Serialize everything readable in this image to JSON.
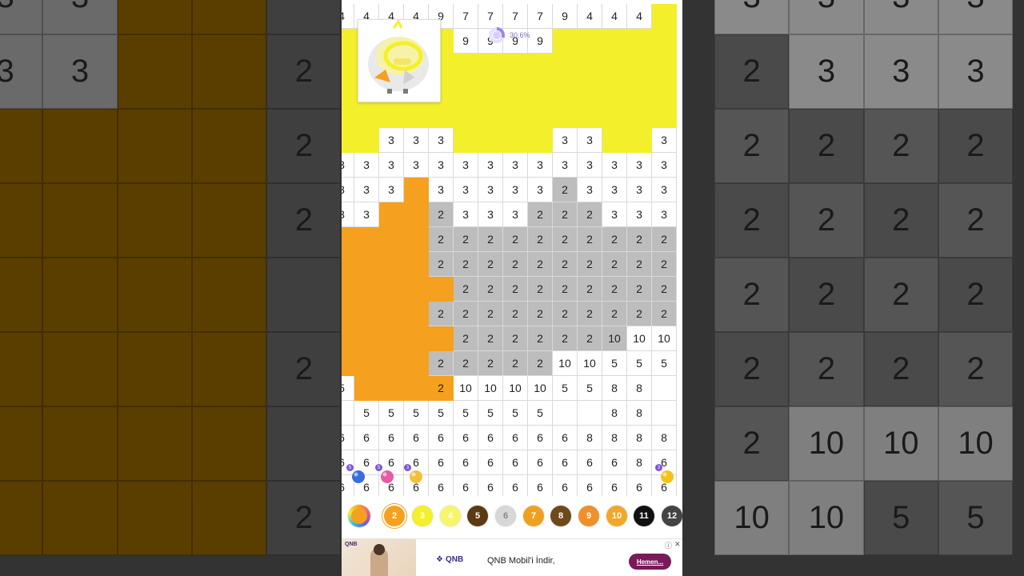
{
  "progress": {
    "percent_label": "30.6%",
    "value": 0.306
  },
  "grid_rows": [
    [
      "4",
      "4",
      "4",
      "4",
      "9",
      "7",
      "7",
      "7",
      "7",
      "9",
      "4",
      "4",
      "4",
      ""
    ],
    [
      "",
      "",
      "",
      "",
      "",
      "9",
      "9",
      "9",
      "9",
      "",
      "",
      "",
      "",
      ""
    ],
    [
      "",
      "",
      "",
      "",
      "",
      "",
      "",
      "",
      "",
      "",
      "",
      "",
      "",
      ""
    ],
    [
      "",
      "",
      "",
      "",
      "",
      "",
      "",
      "",
      "",
      "",
      "",
      "",
      "",
      ""
    ],
    [
      "",
      "",
      "",
      "",
      "",
      "",
      "",
      "",
      "",
      "",
      "",
      "",
      "",
      ""
    ],
    [
      "",
      "",
      "3",
      "3",
      "3",
      "",
      "",
      "",
      "",
      "3",
      "3",
      "",
      "",
      "3"
    ],
    [
      "3",
      "3",
      "3",
      "3",
      "3",
      "3",
      "3",
      "3",
      "3",
      "3",
      "3",
      "3",
      "3",
      "3"
    ],
    [
      "3",
      "3",
      "3",
      "",
      "3",
      "3",
      "3",
      "3",
      "3",
      "2",
      "3",
      "3",
      "3",
      "3"
    ],
    [
      "3",
      "3",
      "",
      "",
      "2",
      "3",
      "3",
      "3",
      "2",
      "2",
      "2",
      "3",
      "3",
      "3"
    ],
    [
      "",
      "",
      "",
      "",
      "2",
      "2",
      "2",
      "2",
      "2",
      "2",
      "2",
      "2",
      "2",
      "2"
    ],
    [
      "",
      "",
      "",
      "",
      "2",
      "2",
      "2",
      "2",
      "2",
      "2",
      "2",
      "2",
      "2",
      "2"
    ],
    [
      "",
      "",
      "",
      "",
      "",
      "2",
      "2",
      "2",
      "2",
      "2",
      "2",
      "2",
      "2",
      "2"
    ],
    [
      "",
      "",
      "",
      "",
      "2",
      "2",
      "2",
      "2",
      "2",
      "2",
      "2",
      "2",
      "2",
      "2"
    ],
    [
      "",
      "",
      "",
      "",
      "",
      "2",
      "2",
      "2",
      "2",
      "2",
      "2",
      "10",
      "10",
      "10"
    ],
    [
      "",
      "",
      "",
      "",
      "2",
      "2",
      "2",
      "2",
      "2",
      "10",
      "10",
      "5",
      "5",
      "5"
    ],
    [
      "5",
      "",
      "",
      "",
      "2",
      "10",
      "10",
      "10",
      "10",
      "5",
      "5",
      "8",
      "8",
      ""
    ],
    [
      "",
      "5",
      "5",
      "5",
      "5",
      "5",
      "5",
      "5",
      "5",
      "",
      "",
      "8",
      "8",
      ""
    ],
    [
      "6",
      "6",
      "6",
      "6",
      "6",
      "6",
      "6",
      "6",
      "6",
      "6",
      "8",
      "8",
      "8",
      "8"
    ],
    [
      "6",
      "6",
      "6",
      "6",
      "6",
      "6",
      "6",
      "6",
      "6",
      "6",
      "6",
      "6",
      "8",
      "6"
    ],
    [
      "6",
      "6",
      "6",
      "6",
      "6",
      "6",
      "6",
      "6",
      "6",
      "6",
      "6",
      "6",
      "6",
      "6"
    ]
  ],
  "grid_fills": [
    "wwwwwwwwwwwwwy",
    "yyyyywwwwyyyyy",
    "yyyyyyyyyyyyyy",
    "yyyyyyyyyyyyyy",
    "yyyyyyyyyyyyyy",
    "yywwwyyyywwyyw",
    "wwwwwwwwwwwwww",
    "wwwowwwwwgwwww",
    "wwoogwwwgggwww",
    "oooogggggggggg",
    "oooogggggggggg",
    "oooooggggggggg",
    "oooogggggggggg",
    "ooooogggggggww",
    "oooogggggwwwww",
    "woooowwwwwwwww",
    "wwwwwwwwwwwwwe",
    "wwwwwwwwwwwwww",
    "wwwwwwwwwwwwww",
    "wwwwwwwwwwwwww"
  ],
  "fill_colors": {
    "w": "#ffffff",
    "y": "#f3ef2a",
    "o": "#f5a01f",
    "g": "#bdbdbd",
    "e": "#ffffff"
  },
  "tools": [
    {
      "name": "bomb-icon",
      "count": "5"
    },
    {
      "name": "eraser-icon",
      "count": "5"
    },
    {
      "name": "magic-wand-icon",
      "count": "3"
    },
    {
      "name": "hint-bulb-icon",
      "count": "3"
    }
  ],
  "palette": [
    {
      "label": "",
      "color": "#f5a01f",
      "selected": true,
      "name": "color-wheel"
    },
    {
      "label": "2",
      "color": "#f5a01f"
    },
    {
      "label": "3",
      "color": "#f3ef2a"
    },
    {
      "label": "4",
      "color": "#f7f56a"
    },
    {
      "label": "5",
      "color": "#5b3a12"
    },
    {
      "label": "6",
      "color": "#d7d7d7"
    },
    {
      "label": "7",
      "color": "#f0a020"
    },
    {
      "label": "8",
      "color": "#6e4a1a"
    },
    {
      "label": "9",
      "color": "#f0902a"
    },
    {
      "label": "10",
      "color": "#f2a62a"
    },
    {
      "label": "11",
      "color": "#111111"
    },
    {
      "label": "12",
      "color": "#444444"
    }
  ],
  "ad": {
    "brand": "QNB",
    "logo_text": "QNB",
    "headline": "QNB Mobil'i İndir,",
    "cta": "Hemen...",
    "info": "ⓘ",
    "close": "✕"
  },
  "background_cells": [
    [
      "3",
      "3",
      "",
      "",
      "",
      "",
      "",
      "",
      "",
      "",
      "3",
      "3",
      "3",
      "3"
    ],
    [
      "3",
      "3",
      "",
      "",
      "2",
      "",
      "",
      "",
      "",
      "",
      "2",
      "3",
      "3",
      "3"
    ],
    [
      "",
      "",
      "",
      "",
      "2",
      "",
      "",
      "",
      "",
      "",
      "2",
      "2",
      "2",
      "2"
    ],
    [
      "",
      "",
      "",
      "",
      "2",
      "",
      "",
      "",
      "",
      "",
      "2",
      "2",
      "2",
      "2"
    ],
    [
      "",
      "",
      "",
      "",
      "",
      "",
      "",
      "",
      "",
      "",
      "2",
      "2",
      "2",
      "2"
    ],
    [
      "",
      "",
      "",
      "",
      "2",
      "",
      "",
      "",
      "",
      "",
      "2",
      "2",
      "2",
      "2"
    ],
    [
      "",
      "",
      "",
      "",
      "",
      "",
      "",
      "",
      "",
      "",
      "2",
      "10",
      "10",
      "10"
    ],
    [
      "",
      "",
      "",
      "",
      "2",
      "",
      "",
      "",
      "",
      "",
      "10",
      "10",
      "5",
      "5"
    ]
  ]
}
